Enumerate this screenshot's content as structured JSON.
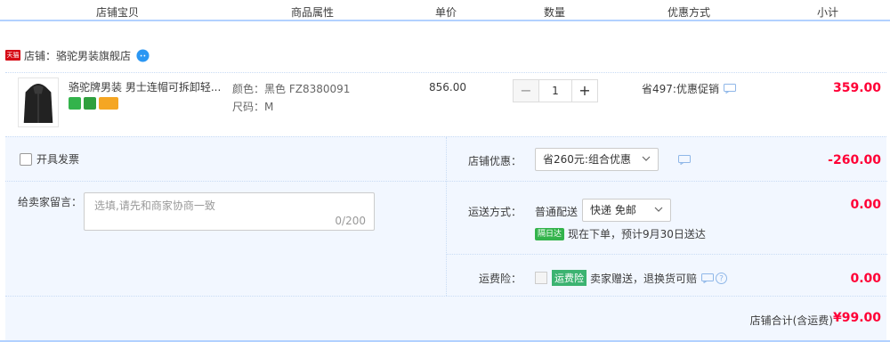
{
  "columns": [
    "店铺宝贝",
    "商品属性",
    "单价",
    "数量",
    "优惠方式",
    "小计"
  ],
  "shop": {
    "badge": "天猫",
    "label": "店铺：骆驼男装旗舰店"
  },
  "item": {
    "title": "骆驼牌男装 男士连帽可拆卸轻...",
    "attr_color": "颜色：黑色 FZ8380091",
    "attr_size": "尺码：M",
    "price": "856.00",
    "qty_minus": "−",
    "qty_value": "1",
    "qty_plus": "+",
    "promo": "省497:优惠促销",
    "subtotal": "359.00",
    "service_icons": [
      "seven-day-return-icon",
      "guarantee-icon",
      "card-icon"
    ],
    "service_colors": [
      "#33b34b",
      "#2fa03e",
      "#f5a623"
    ]
  },
  "invoice": {
    "label": "开具发票"
  },
  "message": {
    "label": "给卖家留言：",
    "placeholder": "选填,请先和商家协商一致",
    "count": "0/200"
  },
  "shop_discount": {
    "label": "店铺优惠：",
    "selected": "省260元:组合优惠",
    "amount": "-260.00"
  },
  "shipping": {
    "label": "运送方式：",
    "method": "普通配送",
    "selected": "快递 免邮",
    "badge": "隔日达",
    "eta": "现在下单，预计9月30日送达",
    "amount": "0.00"
  },
  "insurance": {
    "label": "运费险：",
    "tag": "运费险",
    "text": "卖家赠送，退换货可赔",
    "amount": "0.00"
  },
  "total": {
    "label": "店铺合计(含运费)",
    "value": "¥99.00"
  }
}
